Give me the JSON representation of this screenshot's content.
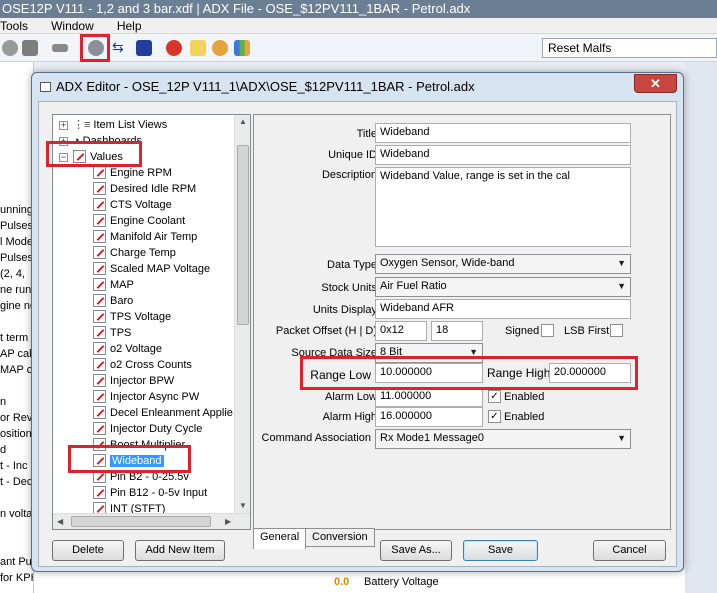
{
  "app": {
    "title": "OSE12P V111 - 1,2 and 3 bar.xdf | ADX File - OSE_$12PV111_1BAR - Petrol.adx",
    "menu": [
      "Tools",
      "Window",
      "Help"
    ],
    "reset_malfs": "Reset Malfs",
    "left_strip": [
      "unning",
      "Pulses",
      "l Mode",
      "Pulses",
      " (2, 4,",
      "ne runn",
      "gine no",
      "",
      "t term",
      "AP calc",
      "MAP c",
      "",
      "n",
      "or Reve",
      "osition",
      "d",
      "t - Inc",
      "t - Dec",
      "",
      "n volta",
      "",
      "",
      "ant Pul",
      " for KPH"
    ],
    "bottom_value": "0.0",
    "bottom_label": "Battery Voltage"
  },
  "dialog": {
    "title": "ADX Editor - OSE_12P V111_1\\ADX\\OSE_$12PV111_1BAR - Petrol.adx",
    "close": "✕",
    "tree": {
      "top_items": [
        "Item List Views",
        "Dashboards",
        "Values"
      ],
      "children": [
        "Engine RPM",
        "Desired Idle RPM",
        "CTS Voltage",
        "Engine Coolant",
        "Manifold Air Temp",
        "Charge Temp",
        "Scaled MAP Voltage",
        "MAP",
        "Baro",
        "TPS Voltage",
        "TPS",
        "o2 Voltage",
        "o2 Cross Counts",
        "Injector BPW",
        "Injector Async PW",
        "Decel Enleanment Applie",
        "Injector Duty Cycle",
        "Boost Multiplier",
        "Wideband",
        "Pin B2 - 0-25.5v",
        "Pin B12 - 0-5v Input",
        "INT (STFT)"
      ],
      "selected": "Wideband"
    },
    "form": {
      "title_label": "Title",
      "title_value": "Wideband",
      "unique_id_label": "Unique ID",
      "unique_id_value": "Wideband",
      "description_label": "Description",
      "description_value": "Wideband Value, range is set in the cal",
      "data_type_label": "Data Type",
      "data_type_value": "Oxygen Sensor, Wide-band",
      "stock_units_label": "Stock Units",
      "stock_units_value": "Air Fuel Ratio",
      "units_display_label": "Units Display",
      "units_display_value": "Wideband AFR",
      "packet_offset_label": "Packet Offset (H | D)",
      "packet_offset_hex": "0x12",
      "packet_offset_dec": "18",
      "signed_label": "Signed",
      "lsb_first_label": "LSB First",
      "source_size_label": "Source Data Size",
      "source_size_value": "8 Bit",
      "range_low_label": "Range Low",
      "range_low_value": "10.000000",
      "range_high_label": "Range High",
      "range_high_value": "20.000000",
      "alarm_low_label": "Alarm Low",
      "alarm_low_value": "11.000000",
      "alarm_high_label": "Alarm High",
      "alarm_high_value": "16.000000",
      "enabled_label": "Enabled",
      "command_assoc_label": "Command Association",
      "command_assoc_value": "Rx Mode1 Message0"
    },
    "tabs": [
      "General",
      "Conversion"
    ],
    "buttons": {
      "delete": "Delete",
      "add_new": "Add New Item",
      "save_as": "Save As...",
      "save": "Save",
      "cancel": "Cancel"
    }
  },
  "colors": {
    "highlight": "#e0202a",
    "selection": "#3399ff"
  }
}
